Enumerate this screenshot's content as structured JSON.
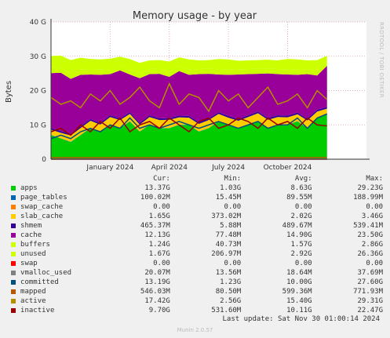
{
  "chart_data": {
    "type": "area",
    "title": "Memory usage - by year",
    "ylabel": "Bytes",
    "side_text": "RRDTOOL / TOBI OETIKER",
    "ylim": [
      0,
      40
    ],
    "yticks": [
      {
        "v": 0,
        "label": "0"
      },
      {
        "v": 10,
        "label": "10 G"
      },
      {
        "v": 20,
        "label": "20 G"
      },
      {
        "v": 30,
        "label": "30 G"
      },
      {
        "v": 40,
        "label": "40 G"
      }
    ],
    "xlim": [
      0,
      16
    ],
    "xticks": [
      {
        "v": 3,
        "label": "January 2024"
      },
      {
        "v": 6,
        "label": "April 2024"
      },
      {
        "v": 9,
        "label": "July 2024"
      },
      {
        "v": 12,
        "label": "October 2024"
      }
    ],
    "x": [
      0,
      0.5,
      1,
      1.5,
      2,
      2.5,
      3,
      3.5,
      4,
      4.5,
      5,
      5.5,
      6,
      6.5,
      7,
      7.5,
      8,
      8.5,
      9,
      9.5,
      10,
      10.5,
      11,
      11.5,
      12,
      12.5,
      13,
      13.5,
      14
    ],
    "series": [
      {
        "name": "apps",
        "color": "#00cc00",
        "values": [
          7,
          6,
          5,
          7,
          9,
          8,
          10,
          9,
          11,
          8,
          10,
          9,
          9,
          10,
          10,
          8,
          9,
          11,
          10,
          9,
          10,
          11,
          9,
          10,
          10,
          11,
          9,
          12,
          13
        ]
      },
      {
        "name": "page_tables",
        "color": "#0066b3",
        "values": [
          0.1,
          0.1,
          0.1,
          0.1,
          0.1,
          0.1,
          0.1,
          0.1,
          0.1,
          0.1,
          0.1,
          0.1,
          0.1,
          0.1,
          0.1,
          0.1,
          0.1,
          0.1,
          0.1,
          0.1,
          0.1,
          0.1,
          0.1,
          0.1,
          0.1,
          0.1,
          0.1,
          0.1,
          0.1
        ]
      },
      {
        "name": "swap_cache",
        "color": "#ff8000",
        "values": [
          0,
          0,
          0,
          0,
          0,
          0,
          0,
          0,
          0,
          0,
          0,
          0,
          0,
          0,
          0,
          0,
          0,
          0,
          0,
          0,
          0,
          0,
          0,
          0,
          0,
          0,
          0,
          0,
          0
        ]
      },
      {
        "name": "slab_cache",
        "color": "#ffcc00",
        "values": [
          1.5,
          1.6,
          1.8,
          2,
          2.1,
          2,
          2.2,
          2.3,
          2.1,
          2,
          2.2,
          2.3,
          2.4,
          2.1,
          2,
          2.2,
          2.3,
          2.1,
          2,
          2.1,
          2.2,
          2.3,
          2.4,
          2.2,
          2.1,
          2,
          2.2,
          1.8,
          1.65
        ]
      },
      {
        "name": "shmem",
        "color": "#330099",
        "values": [
          0.5,
          0.5,
          0.5,
          0.5,
          0.5,
          0.5,
          0.5,
          0.5,
          0.5,
          0.5,
          0.5,
          0.5,
          0.5,
          0.5,
          0.5,
          0.5,
          0.5,
          0.5,
          0.5,
          0.5,
          0.5,
          0.5,
          0.5,
          0.5,
          0.5,
          0.5,
          0.5,
          0.5,
          0.47
        ]
      },
      {
        "name": "cache",
        "color": "#990099",
        "values": [
          16,
          17,
          16,
          15,
          13,
          14,
          12,
          14,
          11,
          13,
          12,
          13,
          12,
          13,
          12,
          14,
          13,
          11,
          12,
          13,
          12,
          11,
          13,
          12,
          12,
          11,
          13,
          10,
          12
        ]
      },
      {
        "name": "buffers",
        "color": "#ccff00",
        "values": [
          2,
          1.5,
          1.5,
          1.5,
          1.5,
          1.5,
          1.5,
          1.5,
          1.5,
          1.5,
          1.5,
          1.5,
          1.5,
          1.5,
          1.5,
          1.5,
          1.5,
          1.5,
          1.5,
          1.5,
          1.5,
          1.5,
          1.5,
          1.5,
          1.5,
          1.5,
          1.5,
          1.5,
          1.24
        ]
      },
      {
        "name": "unused",
        "color": "#ccff00",
        "values": [
          3,
          3.5,
          4,
          3.5,
          3,
          3,
          3,
          2.5,
          3,
          3,
          2.5,
          2.5,
          3,
          2.5,
          3,
          2.5,
          2.5,
          3,
          3,
          2.5,
          2.5,
          2.5,
          2.5,
          2.5,
          3,
          3,
          2.5,
          3,
          1.67
        ]
      },
      {
        "name": "swap",
        "color": "#ff0000",
        "values": [
          0,
          0,
          0,
          0,
          0,
          0,
          0,
          0,
          0,
          0,
          0,
          0,
          0,
          0,
          0,
          0,
          0,
          0,
          0,
          0,
          0,
          0,
          0,
          0,
          0,
          0,
          0,
          0,
          0
        ]
      },
      {
        "name": "vmalloc_used",
        "color": "#808080",
        "values": [
          0.02,
          0.02,
          0.02,
          0.02,
          0.02,
          0.02,
          0.02,
          0.02,
          0.02,
          0.02,
          0.02,
          0.02,
          0.02,
          0.02,
          0.02,
          0.02,
          0.02,
          0.02,
          0.02,
          0.02,
          0.02,
          0.02,
          0.02,
          0.02,
          0.02,
          0.02,
          0.02,
          0.02,
          0.02
        ]
      },
      {
        "name": "committed",
        "color": "#004d80",
        "values": [
          6,
          7,
          6,
          8,
          9,
          8,
          10,
          9,
          12,
          9,
          10,
          9,
          10,
          11,
          10,
          9,
          10,
          11,
          10,
          9,
          10,
          11,
          9,
          10,
          10,
          12,
          9,
          12,
          13.2
        ]
      },
      {
        "name": "mapped",
        "color": "#b35a00",
        "values": [
          0.5,
          0.5,
          0.5,
          0.5,
          0.5,
          0.5,
          0.5,
          0.5,
          0.5,
          0.5,
          0.5,
          0.5,
          0.5,
          0.5,
          0.5,
          0.5,
          0.5,
          0.5,
          0.5,
          0.5,
          0.5,
          0.5,
          0.5,
          0.5,
          0.5,
          0.5,
          0.5,
          0.5,
          0.55
        ]
      },
      {
        "name": "active",
        "color": "#b38f00",
        "values": [
          18,
          16,
          17,
          15,
          19,
          17,
          20,
          16,
          18,
          21,
          17,
          15,
          22,
          16,
          19,
          18,
          14,
          20,
          17,
          19,
          15,
          18,
          21,
          16,
          17,
          19,
          15,
          20,
          17.4
        ]
      },
      {
        "name": "inactive",
        "color": "#990000",
        "values": [
          8,
          9,
          7,
          10,
          8,
          11,
          9,
          12,
          8,
          10,
          11,
          9,
          12,
          10,
          8,
          11,
          12,
          9,
          10,
          12,
          11,
          9,
          12,
          10,
          11,
          9,
          12,
          10,
          9.7
        ]
      }
    ],
    "stacked_series": [
      "apps",
      "page_tables",
      "swap_cache",
      "slab_cache",
      "shmem",
      "cache",
      "buffers",
      "unused"
    ],
    "line_series": [
      "swap",
      "vmalloc_used",
      "committed",
      "mapped",
      "active",
      "inactive"
    ],
    "grid": true
  },
  "legend": {
    "headers": {
      "cur": "Cur:",
      "min": "Min:",
      "avg": "Avg:",
      "max": "Max:"
    },
    "rows": [
      {
        "name": "apps",
        "color": "#00cc00",
        "cur": "13.37G",
        "min": "1.03G",
        "avg": "8.63G",
        "max": "29.23G"
      },
      {
        "name": "page_tables",
        "color": "#0066b3",
        "cur": "100.02M",
        "min": "15.45M",
        "avg": "89.55M",
        "max": "188.99M"
      },
      {
        "name": "swap_cache",
        "color": "#ff8000",
        "cur": "0.00",
        "min": "0.00",
        "avg": "0.00",
        "max": "0.00"
      },
      {
        "name": "slab_cache",
        "color": "#ffcc00",
        "cur": "1.65G",
        "min": "373.02M",
        "avg": "2.02G",
        "max": "3.46G"
      },
      {
        "name": "shmem",
        "color": "#330099",
        "cur": "465.37M",
        "min": "5.88M",
        "avg": "489.67M",
        "max": "539.41M"
      },
      {
        "name": "cache",
        "color": "#990099",
        "cur": "12.13G",
        "min": "77.48M",
        "avg": "14.90G",
        "max": "23.50G"
      },
      {
        "name": "buffers",
        "color": "#ccff00",
        "cur": "1.24G",
        "min": "40.73M",
        "avg": "1.57G",
        "max": "2.86G"
      },
      {
        "name": "unused",
        "color": "#ccff00",
        "cur": "1.67G",
        "min": "206.97M",
        "avg": "2.92G",
        "max": "26.36G"
      },
      {
        "name": "swap",
        "color": "#ff0000",
        "cur": "0.00",
        "min": "0.00",
        "avg": "0.00",
        "max": "0.00"
      },
      {
        "name": "vmalloc_used",
        "color": "#808080",
        "cur": "20.07M",
        "min": "13.56M",
        "avg": "18.64M",
        "max": "37.69M"
      },
      {
        "name": "committed",
        "color": "#004d80",
        "cur": "13.19G",
        "min": "1.23G",
        "avg": "10.00G",
        "max": "27.60G"
      },
      {
        "name": "mapped",
        "color": "#b35a00",
        "cur": "546.03M",
        "min": "80.50M",
        "avg": "599.36M",
        "max": "771.93M"
      },
      {
        "name": "active",
        "color": "#b38f00",
        "cur": "17.42G",
        "min": "2.56G",
        "avg": "15.40G",
        "max": "29.31G"
      },
      {
        "name": "inactive",
        "color": "#990000",
        "cur": "9.70G",
        "min": "531.60M",
        "avg": "10.11G",
        "max": "22.47G"
      }
    ]
  },
  "footer": {
    "last_update": "Last update: Sat Nov 30 01:00:14 2024",
    "version": "Munin 2.0.57"
  }
}
